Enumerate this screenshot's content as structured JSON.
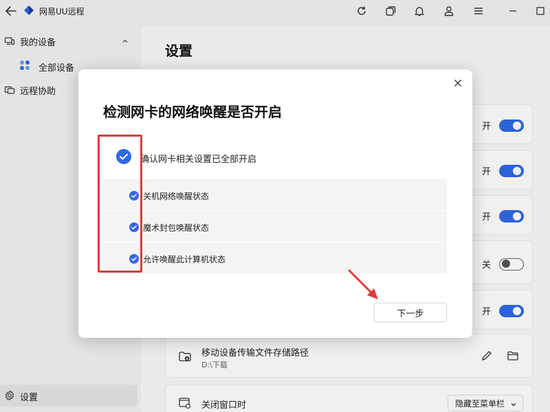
{
  "app": {
    "title": "网易UU远程"
  },
  "sidebar": {
    "devices_label": "我的设备",
    "all_devices_label": "全部设备",
    "remote_assist_label": "远程协助",
    "settings_label": "设置"
  },
  "main": {
    "title": "设置",
    "toggles": [
      {
        "label": "开",
        "state": "on"
      },
      {
        "label": "开",
        "state": "on"
      },
      {
        "label": "开",
        "state": "on"
      },
      {
        "label": "关",
        "state": "off"
      },
      {
        "label": "开",
        "state": "on"
      }
    ],
    "path_card": {
      "title": "移动设备传输文件存储路径",
      "path": "D:\\下载"
    },
    "close_card": {
      "title": "关闭窗口时",
      "dropdown_value": "隐藏至菜单栏"
    }
  },
  "dialog": {
    "title": "检测网卡的网络唤醒是否开启",
    "main_check": "确认网卡相关设置已全部开启",
    "sub_checks": [
      "关机网络唤醒状态",
      "魔术封包唤醒状态",
      "允许唤醒此计算机状态"
    ],
    "next_button": "下一步"
  },
  "colors": {
    "accent": "#2f6ae5",
    "highlight": "#e03a3a"
  }
}
